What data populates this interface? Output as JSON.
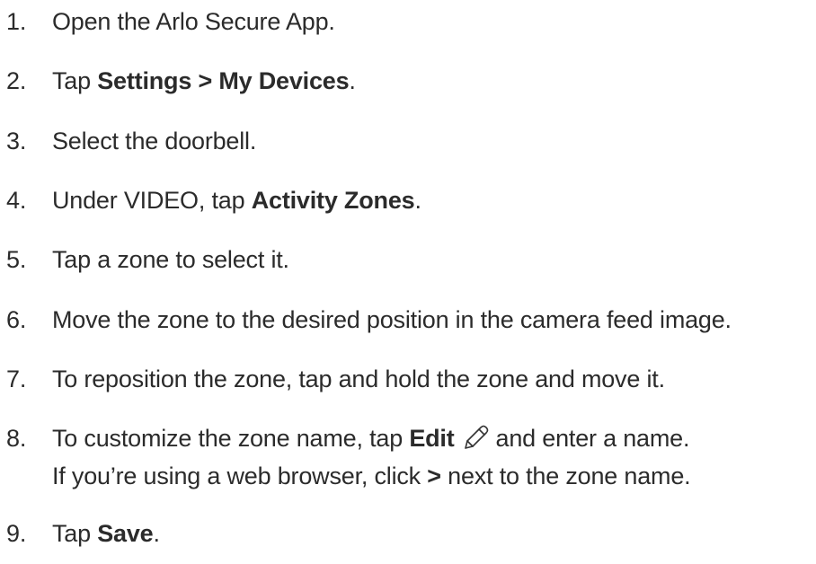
{
  "steps": [
    {
      "number": "1.",
      "text": "Open the Arlo Secure App."
    },
    {
      "number": "2.",
      "pre": "Tap ",
      "bold": "Settings > My Devices",
      "post": "."
    },
    {
      "number": "3.",
      "text": "Select the doorbell."
    },
    {
      "number": "4.",
      "pre": "Under VIDEO, tap ",
      "bold": "Activity Zones",
      "post": "."
    },
    {
      "number": "5.",
      "text": "Tap a zone to select it."
    },
    {
      "number": "6.",
      "text": "Move the zone to the desired position in the camera feed image."
    },
    {
      "number": "7.",
      "text": "To reposition the zone, tap and hold the zone and move it."
    },
    {
      "number": "8.",
      "pre": "To customize the zone name, tap ",
      "bold": "Edit",
      "post": "and enter a name.",
      "line2_pre": "If you’re using a web browser, click ",
      "line2_bold": ">",
      "line2_post": " next to the zone name.",
      "icon": "pencil-edit-icon"
    },
    {
      "number": "9.",
      "pre": "Tap ",
      "bold": "Save",
      "post": "."
    }
  ]
}
